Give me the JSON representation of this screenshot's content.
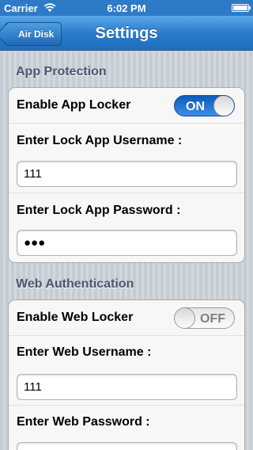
{
  "status_bar": {
    "carrier": "Carrier",
    "time": "6:02 PM"
  },
  "nav": {
    "title": "Settings",
    "back_label": "Air Disk"
  },
  "app_protection": {
    "header": "App Protection",
    "enable_label": "Enable App Locker",
    "enable_state": "ON",
    "username_label": "Enter Lock App Username :",
    "username_value": "111",
    "password_label": "Enter Lock App Password :",
    "password_value": "●●●"
  },
  "web_auth": {
    "header": "Web Authentication",
    "enable_label": "Enable Web Locker",
    "enable_state": "OFF",
    "username_label": "Enter Web Username :",
    "username_value": "111",
    "password_label": "Enter Web Password :",
    "password_value": ""
  }
}
